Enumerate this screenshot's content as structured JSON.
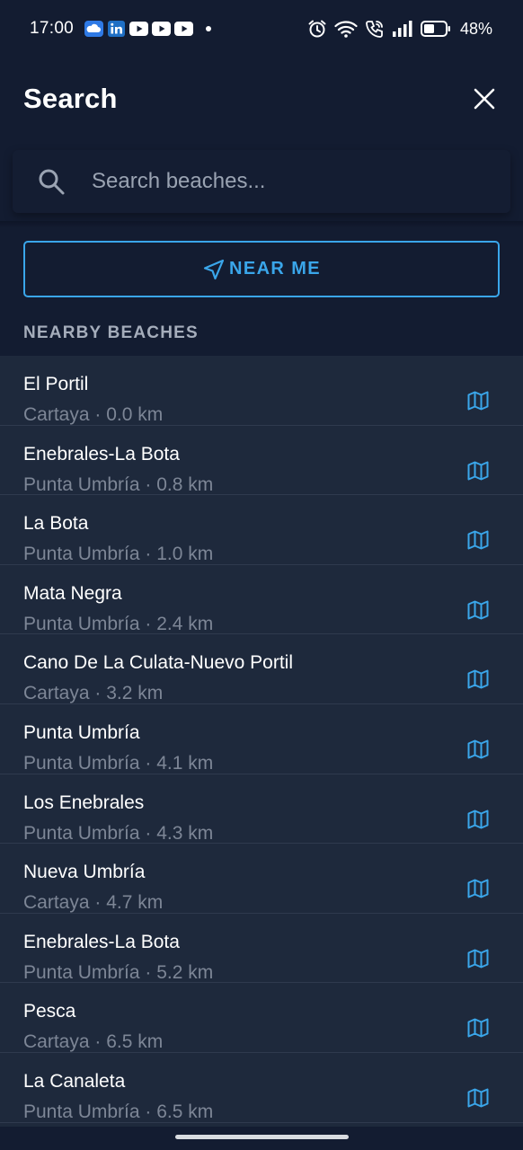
{
  "status_bar": {
    "time": "17:00",
    "notification_icons": [
      "cloud-icon",
      "linkedin-icon",
      "youtube-icon",
      "youtube-icon",
      "youtube-icon"
    ],
    "battery": "48%"
  },
  "header": {
    "title": "Search"
  },
  "search": {
    "placeholder": "Search beaches...",
    "value": ""
  },
  "near_me": {
    "label": "NEAR ME"
  },
  "section": {
    "label": "NEARBY BEACHES"
  },
  "beaches": [
    {
      "name": "El Portil",
      "subtitle": "Cartaya · 0.0 km"
    },
    {
      "name": "Enebrales-La Bota",
      "subtitle": "Punta Umbría · 0.8 km"
    },
    {
      "name": "La Bota",
      "subtitle": "Punta Umbría · 1.0 km"
    },
    {
      "name": "Mata Negra",
      "subtitle": "Punta Umbría · 2.4 km"
    },
    {
      "name": "Cano De La Culata-Nuevo Portil",
      "subtitle": "Cartaya · 3.2 km"
    },
    {
      "name": "Punta Umbría",
      "subtitle": "Punta Umbría · 4.1 km"
    },
    {
      "name": "Los Enebrales",
      "subtitle": "Punta Umbría · 4.3 km"
    },
    {
      "name": "Nueva Umbría",
      "subtitle": "Cartaya · 4.7 km"
    },
    {
      "name": "Enebrales-La Bota",
      "subtitle": "Punta Umbría · 5.2 km"
    },
    {
      "name": "Pesca",
      "subtitle": "Cartaya · 6.5 km"
    },
    {
      "name": "La Canaleta",
      "subtitle": "Punta Umbría · 6.5 km"
    }
  ],
  "colors": {
    "background": "#131c31",
    "list_background": "#1e293c",
    "accent": "#3aa6ea",
    "secondary_text": "#7d8696"
  }
}
